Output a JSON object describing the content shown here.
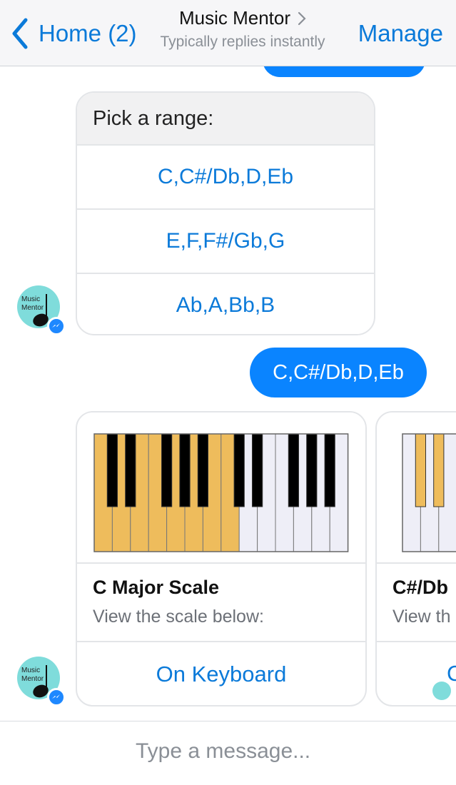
{
  "header": {
    "back_label": "Home (2)",
    "title": "Music Mentor",
    "subtitle": "Typically replies instantly",
    "manage_label": "Manage"
  },
  "quick_reply": {
    "prompt": "Pick a range:",
    "options": [
      "C,C#/Db,D,Eb",
      "E,F,F#/Gb,G",
      "Ab,A,Bb,B"
    ]
  },
  "avatar": {
    "text_line1": "Music",
    "text_line2": "Mentor",
    "icon": "music-note-icon",
    "badge_icon": "messenger-badge-icon"
  },
  "outgoing_message": "C,C#/Db,D,Eb",
  "cards": [
    {
      "title": "C Major Scale",
      "subtitle": "View the scale below:",
      "button": "On Keyboard"
    },
    {
      "title": "C#/Db",
      "subtitle": "View th",
      "button": "C"
    }
  ],
  "composer": {
    "placeholder": "Type a message..."
  },
  "colors": {
    "accent": "#0b7ad9",
    "bubble": "#0a84ff",
    "highlight_key": "#eebc5c",
    "white_key": "#eeeef7",
    "avatar_bg": "#7fdcdb"
  }
}
